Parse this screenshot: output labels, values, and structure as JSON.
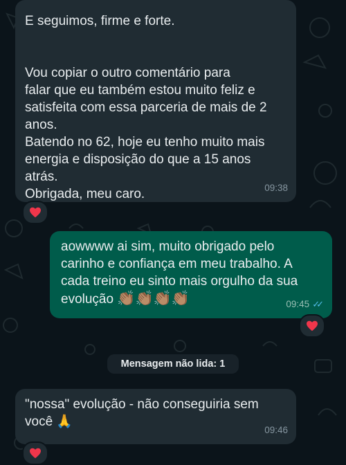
{
  "messages": [
    {
      "direction": "incoming",
      "text": "E seguimos, firme e forte.\n\n\nVou copiar o outro comentário para\nfalar que eu também estou muito feliz e\nsatisfeita com essa parceria de mais de 2\nanos.\nBatendo no 62, hoje eu tenho muito mais\nenergia e disposição do que a 15 anos\natrás.\nObrigada, meu caro.",
      "time": "09:38",
      "reaction": "heart-icon"
    },
    {
      "direction": "outgoing",
      "text": "aowwww ai sim, muito obrigado pelo\ncarinho e confiança em meu trabalho. A\ncada treino eu sinto mais orgulho da sua\nevolução",
      "emoji": "👏🏽👏🏽👏🏽👏🏽",
      "time": "09:45",
      "status_ticks": "✓✓",
      "reaction": "heart-icon"
    },
    {
      "direction": "incoming",
      "text": "\"nossa\" evolução - não conseguiria sem\nvocê",
      "emoji": "🙏",
      "time": "09:46",
      "reaction": "heart-icon"
    }
  ],
  "unread_divider": "Mensagem não lida: 1",
  "colors": {
    "background": "#0b141a",
    "incoming_bubble": "#202c33",
    "outgoing_bubble": "#005c4b",
    "heart": "#f0364b",
    "read_ticks": "#53bdeb"
  }
}
